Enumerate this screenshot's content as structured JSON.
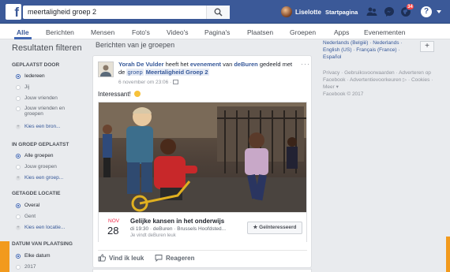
{
  "topbar": {
    "logo": "f",
    "search_value": "meertaligheid groep 2",
    "user_name": "Liselotte",
    "home_label": "Startpagina",
    "notif_count": "34",
    "help_label": "?"
  },
  "tabs": [
    "Alle",
    "Berichten",
    "Mensen",
    "Foto's",
    "Video's",
    "Pagina's",
    "Plaatsen",
    "Groepen",
    "Apps",
    "Evenementen"
  ],
  "filters": {
    "title": "Resultaten filteren",
    "sections": [
      {
        "heading": "GEPLAATST DOOR",
        "items": [
          "Iedereen",
          "Jij",
          "Jouw vrienden",
          "Jouw vrienden en",
          "groepen",
          "Kies een bron..."
        ]
      },
      {
        "heading": "IN GROEP GEPLAATST",
        "items": [
          "Alle groepen",
          "Jouw groepen",
          "Kies een groep..."
        ]
      },
      {
        "heading": "GETAGDE LOCATIE",
        "items": [
          "Overal",
          "Gent",
          "Kies een locatie..."
        ]
      },
      {
        "heading": "DATUM VAN PLAATSING",
        "items": [
          "Elke datum",
          "2017"
        ]
      }
    ]
  },
  "main": {
    "title": "Berichten van je groepen",
    "post": {
      "author": "Yorah De Vulder",
      "text_1": " heeft het ",
      "event_word": "evenement",
      "text_2": " van ",
      "page": "deBuren",
      "text_3": " gedeeld met de ",
      "group_word": "groep",
      "group_name": "Meertaligheid Groep 2",
      "time": "6 november om 23:06 · ",
      "body": "Interessant! ",
      "more": "···",
      "event": {
        "month": "NOV",
        "day": "28",
        "title": "Gelijke kansen in het onderwijs",
        "details": "di 19:30 · deBuren · Brussels Hoofdsted...",
        "likes": "Je vindt deBuren leuk",
        "button": "★ Geïnteresseerd"
      },
      "like_label": "Vind ik leuk",
      "comment_label": "Reageren"
    }
  },
  "right": {
    "languages": "Nederlands (België) · Nederlands · English (US) · Français (France) · Español",
    "add": "+",
    "footer": "Privacy · Gebruiksvoorwaarden · Adverteren op Facebook · Advertentievoorkeuren ▷ · Cookies · Meer ▾",
    "copyright": "Facebook © 2017"
  },
  "colors": {
    "brand": "#3b5998",
    "accent": "#f29a1d",
    "event_month": "#f02849"
  }
}
